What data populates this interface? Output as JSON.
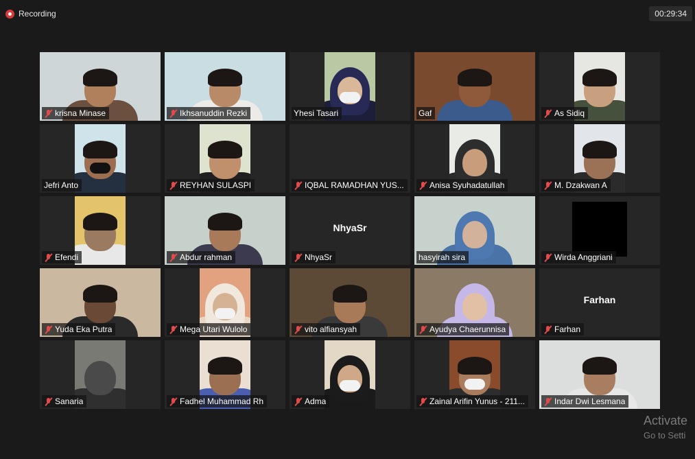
{
  "recording": {
    "label": "Recording"
  },
  "timer": {
    "value": "00:29:34"
  },
  "participants": [
    {
      "name": "krisna Minase",
      "muted": true,
      "video": true,
      "style": "full",
      "bg": "#cfd6d8",
      "skin": "#b07f5b",
      "shirt": "#6b4f3f",
      "hair": true
    },
    {
      "name": "Ikhsanuddin Rezki",
      "muted": true,
      "video": true,
      "style": "full",
      "bg": "#c9dde3",
      "skin": "#b98a67",
      "shirt": "#ecebe8",
      "hair": true
    },
    {
      "name": "Yhesi Tasari",
      "muted": false,
      "video": true,
      "style": "narrow",
      "bg": "#b8c9a3",
      "skin": "#d9b89a",
      "shirt": "#1c1e3a",
      "hijab": "#262a55",
      "mask": true
    },
    {
      "name": "Gaf",
      "muted": false,
      "video": true,
      "style": "full",
      "bg": "#7a4a2f",
      "skin": "#8f5a3c",
      "shirt": "#3a5b8c",
      "hair": true,
      "active": true
    },
    {
      "name": "As Sidiq",
      "muted": true,
      "video": true,
      "style": "narrow",
      "bg": "#e6e6e3",
      "skin": "#c9a07f",
      "shirt": "#45513c",
      "hair": true
    },
    {
      "name": "Jefri Anto",
      "muted": false,
      "video": true,
      "style": "narrow",
      "bg": "#cfe3ea",
      "skin": "#9c6e4f",
      "shirt": "#243040",
      "hair": true,
      "mask": true,
      "maskColor": "#111111"
    },
    {
      "name": "REYHAN SULASPI",
      "muted": true,
      "video": true,
      "style": "narrow",
      "bg": "#dde3cf",
      "skin": "#c08f6c",
      "shirt": "#1f1f1f",
      "hair": true
    },
    {
      "name": "IQBAL RAMADHAN YUS...",
      "muted": true,
      "video": false,
      "style": "none"
    },
    {
      "name": "Anisa Syuhadatullah",
      "muted": true,
      "video": true,
      "style": "narrow",
      "bg": "#e9ece6",
      "skin": "#c79d7c",
      "shirt": "#2a2a2a",
      "hijab": "#2d2d2d"
    },
    {
      "name": "M. Dzakwan A",
      "muted": true,
      "video": true,
      "style": "narrow",
      "bg": "#e2e6ea",
      "skin": "#9c7256",
      "shirt": "#2b2b2b",
      "hair": true
    },
    {
      "name": "Efendi",
      "muted": true,
      "video": true,
      "style": "narrow",
      "bg": "#e3c46a",
      "skin": "#9a7a60",
      "shirt": "#e8e8e8",
      "hair": true
    },
    {
      "name": "Abdur rahman",
      "muted": true,
      "video": true,
      "style": "full",
      "bg": "#c7d1cb",
      "skin": "#a87a5a",
      "shirt": "#3b3a4f",
      "hair": true
    },
    {
      "name": "NhyaSr",
      "muted": true,
      "video": false,
      "style": "initials",
      "initials": "NhyaSr"
    },
    {
      "name": "hasyirah sira",
      "muted": false,
      "video": true,
      "style": "full",
      "bg": "#c8d2cc",
      "skin": "#d2b29a",
      "shirt": "#4a74a8",
      "hijab": "#4d79b0"
    },
    {
      "name": "Wirda Anggriani",
      "muted": true,
      "video": false,
      "style": "black"
    },
    {
      "name": "Yuda Eka Putra",
      "muted": true,
      "video": true,
      "style": "full",
      "bg": "#cbb8a0",
      "skin": "#6a4a36",
      "shirt": "#2a2a2a",
      "hair": true
    },
    {
      "name": "Mega Utari Wulolo",
      "muted": true,
      "video": true,
      "style": "narrow",
      "bg": "#e2a280",
      "skin": "#d6b295",
      "shirt": "#e9d6c4",
      "hijab": "#f0e7dd",
      "mask": true
    },
    {
      "name": "vito alfiansyah",
      "muted": true,
      "video": true,
      "style": "full",
      "bg": "#5c4a36",
      "skin": "#a97a57",
      "shirt": "#3a3a3a",
      "hair": true
    },
    {
      "name": "Ayudya Chaerunnisa",
      "muted": true,
      "video": true,
      "style": "full",
      "bg": "#8a7a66",
      "skin": "#e2c0a5",
      "shirt": "#c4b9e6",
      "hijab": "#c5b8e8"
    },
    {
      "name": "Farhan",
      "muted": true,
      "video": false,
      "style": "initials",
      "initials": "Farhan"
    },
    {
      "name": "Sanaria",
      "muted": true,
      "video": true,
      "style": "narrow",
      "bg": "#7a7a74",
      "skin": "#4a4a4a",
      "shirt": "#2f2f2f",
      "hair": false
    },
    {
      "name": "Fadhel Muhammad Rh",
      "muted": true,
      "video": true,
      "style": "narrow",
      "bg": "#eadfd2",
      "skin": "#9b6f52",
      "shirt": "#4a5fb0",
      "hair": true
    },
    {
      "name": "Adma",
      "muted": true,
      "video": true,
      "style": "narrow",
      "bg": "#e3d8c6",
      "skin": "#cfa887",
      "shirt": "#1a1a1a",
      "hijab": "#1b1b1b",
      "mask": true
    },
    {
      "name": "Zainal Arifin Yunus - 211...",
      "muted": true,
      "video": true,
      "style": "narrow",
      "bg": "#8a4b2d",
      "skin": "#a97c5d",
      "shirt": "#2d2d2d",
      "hair": true,
      "mask": true
    },
    {
      "name": "Indar Dwi Lesmana",
      "muted": true,
      "video": true,
      "style": "full",
      "bg": "#dcdedd",
      "skin": "#a97d60",
      "shirt": "#e7e7e7",
      "hair": true
    }
  ],
  "watermark": {
    "title": "Activate",
    "subtitle": "Go to Setti"
  }
}
